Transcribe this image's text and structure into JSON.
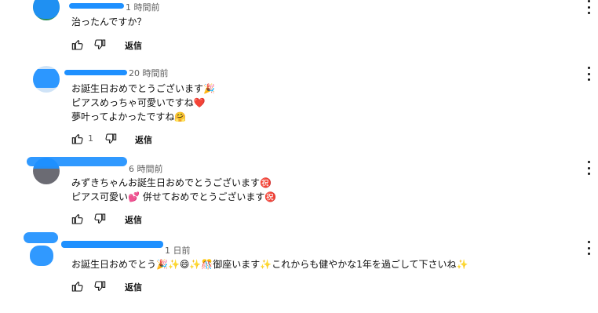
{
  "comments": [
    {
      "time": "1 時間前",
      "lines": [
        "治ったんですか？"
      ],
      "like_count": "",
      "reply_label": "返信"
    },
    {
      "time": "20 時間前",
      "lines": [
        "お誕生日おめでとうございます🎉",
        "ピアスめっちゃ可愛いですね❤️",
        "夢叶ってよかったですね🤗"
      ],
      "like_count": "1",
      "reply_label": "返信"
    },
    {
      "time": "6 時間前",
      "lines": [
        "みずきちゃんお誕生日おめでとうございます㊗️",
        "ピアス可愛い💕 併せておめでとうございます㊗️"
      ],
      "like_count": "",
      "reply_label": "返信"
    },
    {
      "time": "1 日前",
      "lines": [
        "お誕生日おめでとう🎉✨😄✨🎊御座います✨これからも健やかな1年を過ごして下さいね✨"
      ],
      "like_count": "",
      "reply_label": "返信"
    }
  ],
  "colors": {
    "redaction": "#1e90ff",
    "secondary_text": "#606060"
  },
  "icons": {
    "like": "thumb-up-icon",
    "dislike": "thumb-down-icon",
    "menu": "more-vert-icon"
  }
}
